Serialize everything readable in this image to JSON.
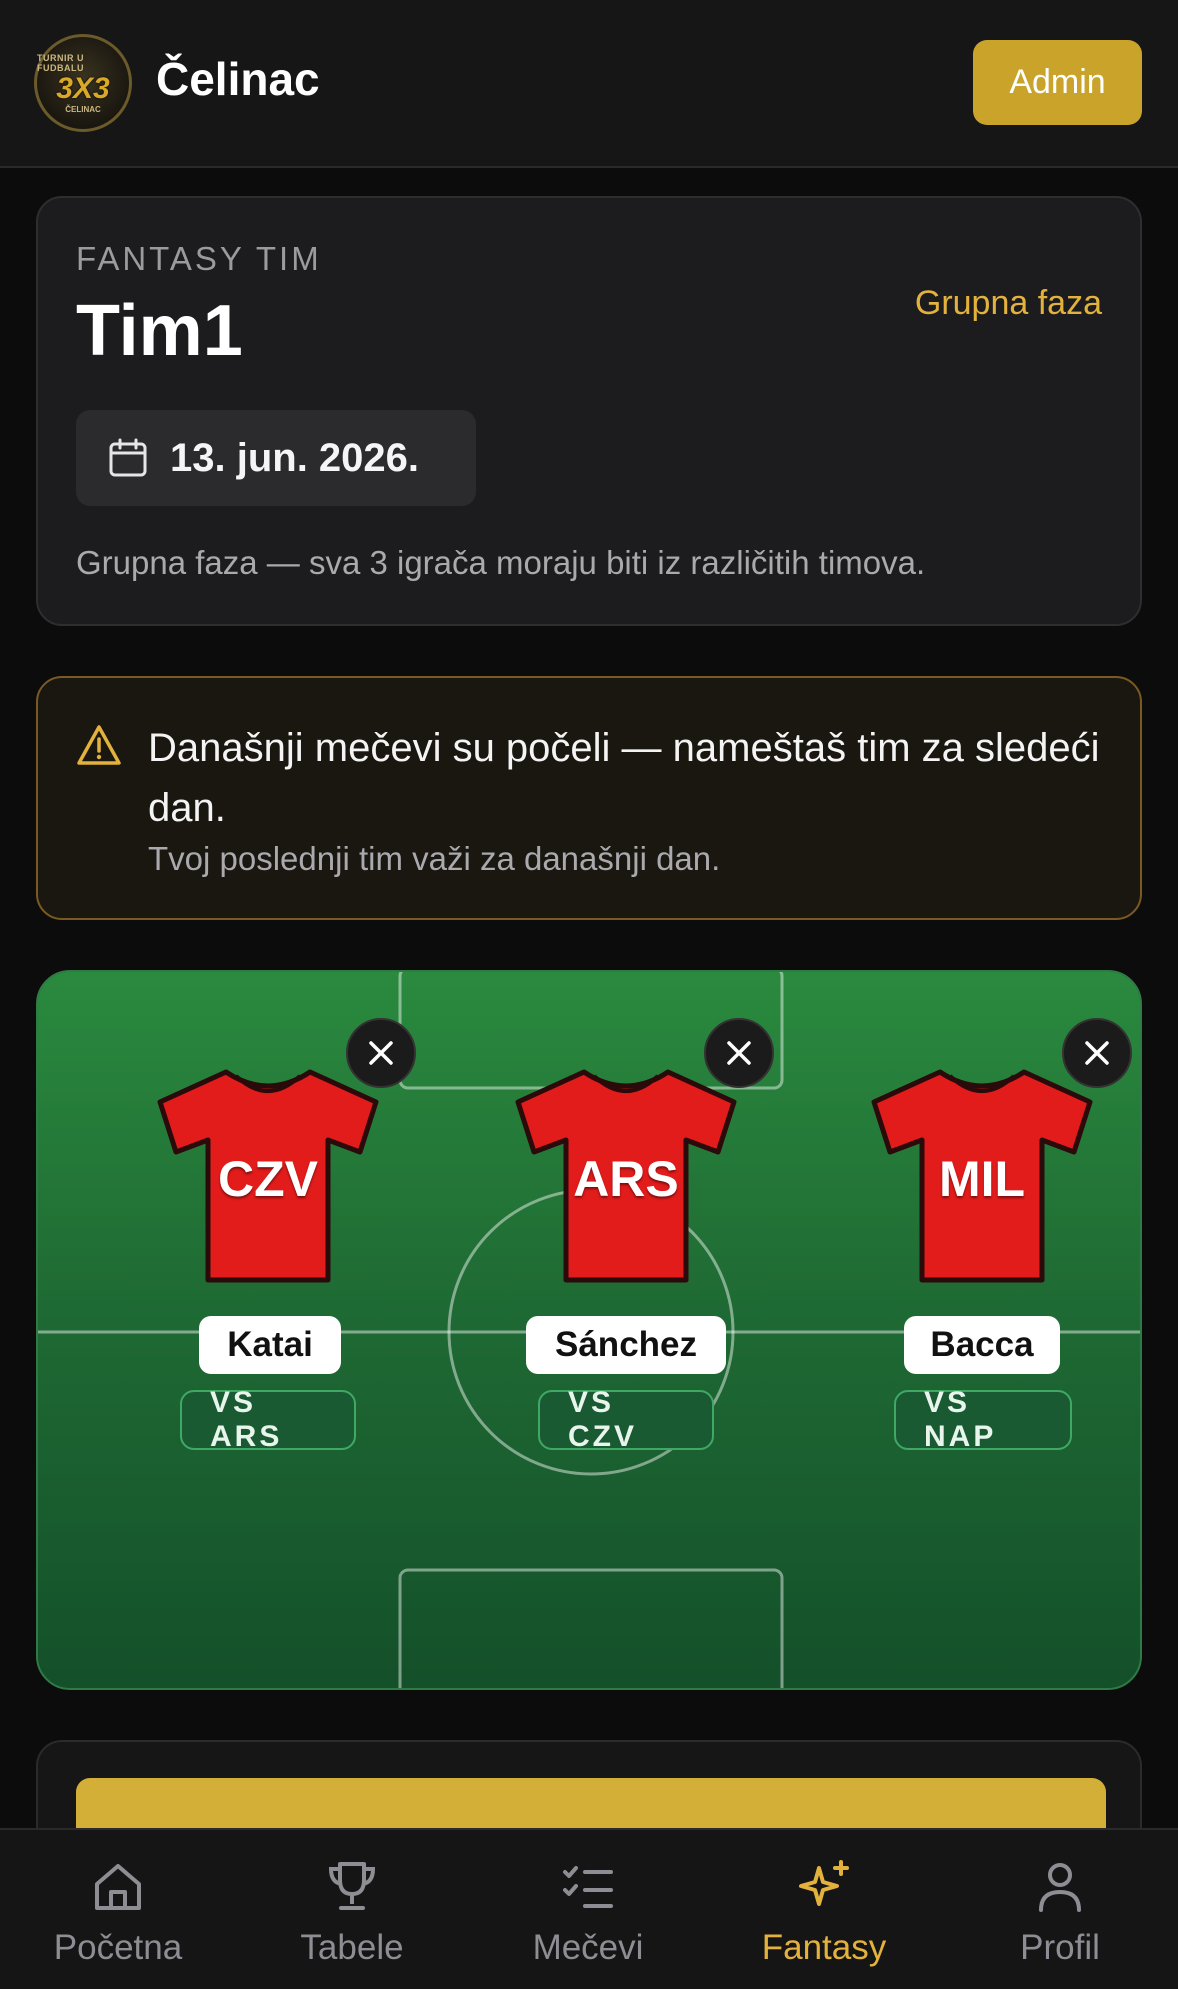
{
  "header": {
    "logo": {
      "line1": "TURNIR U FUDBALU",
      "line2": "3X3",
      "line3": "ČELINAC"
    },
    "title": "Čelinac",
    "admin_label": "Admin"
  },
  "fantasy_card": {
    "kicker": "FANTASY TIM",
    "team_name": "Tim1",
    "phase_link": "Grupna faza",
    "date": "13. jun. 2026.",
    "note": "Grupna faza — sva 3 igrača moraju biti iz različitih timova."
  },
  "warning": {
    "title": "Današnji mečevi su počeli — nameštaš tim za sledeći dan.",
    "subtitle": "Tvoj poslednji tim važi za današnji dan."
  },
  "pitch": {
    "players": [
      {
        "team_code": "CZV",
        "name": "Katai",
        "opponent": "VS ARS"
      },
      {
        "team_code": "ARS",
        "name": "Sánchez",
        "opponent": "VS CZV"
      },
      {
        "team_code": "MIL",
        "name": "Bacca",
        "opponent": "VS NAP"
      }
    ]
  },
  "bottom_nav": {
    "items": [
      {
        "label": "Početna",
        "icon": "home-icon"
      },
      {
        "label": "Tabele",
        "icon": "trophy-icon"
      },
      {
        "label": "Mečevi",
        "icon": "list-check-icon"
      },
      {
        "label": "Fantasy",
        "icon": "sparkles-icon",
        "active": true
      },
      {
        "label": "Profil",
        "icon": "user-icon"
      }
    ]
  },
  "colors": {
    "accent": "#e3b23c",
    "admin_button": "#c9a32a",
    "shirt": "#e21b1b",
    "pitch": "#1f6b34",
    "warning_border": "#7a5a22"
  }
}
